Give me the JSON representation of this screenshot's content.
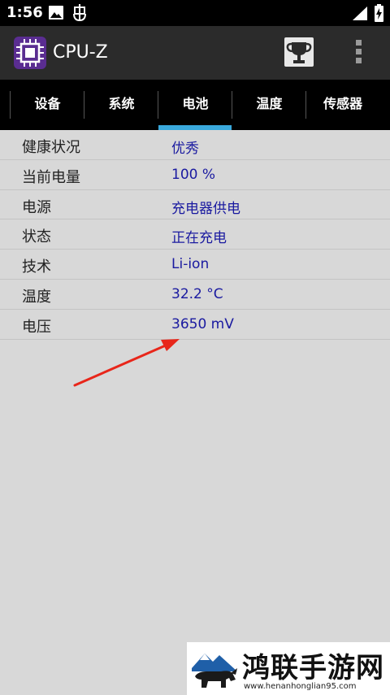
{
  "status_bar": {
    "time": "1:56",
    "icons": [
      "image-icon",
      "bug-icon",
      "signal-icon",
      "battery-charging-icon"
    ]
  },
  "app_bar": {
    "title": "CPU-Z",
    "logo_icon": "cpu-chip-icon",
    "actions": [
      "trophy-icon",
      "more-vert-icon"
    ],
    "logo_color": "#5a2d91"
  },
  "tabs": [
    {
      "label": "设备",
      "active": false
    },
    {
      "label": "系统",
      "active": false
    },
    {
      "label": "电池",
      "active": true
    },
    {
      "label": "温度",
      "active": false
    },
    {
      "label": "传感器",
      "active": false
    }
  ],
  "accent_color": "#3aa9dc",
  "battery": {
    "rows": [
      {
        "label": "健康状况",
        "value": "优秀"
      },
      {
        "label": "当前电量",
        "value": "100 %"
      },
      {
        "label": "电源",
        "value": "充电器供电"
      },
      {
        "label": "状态",
        "value": "正在充电"
      },
      {
        "label": "技术",
        "value": "Li-ion"
      },
      {
        "label": "温度",
        "value": "32.2 °C"
      },
      {
        "label": "电压",
        "value": "3650 mV"
      }
    ]
  },
  "watermark": {
    "title": "鸿联手游网",
    "url": "www.henanhonglian95.com"
  }
}
